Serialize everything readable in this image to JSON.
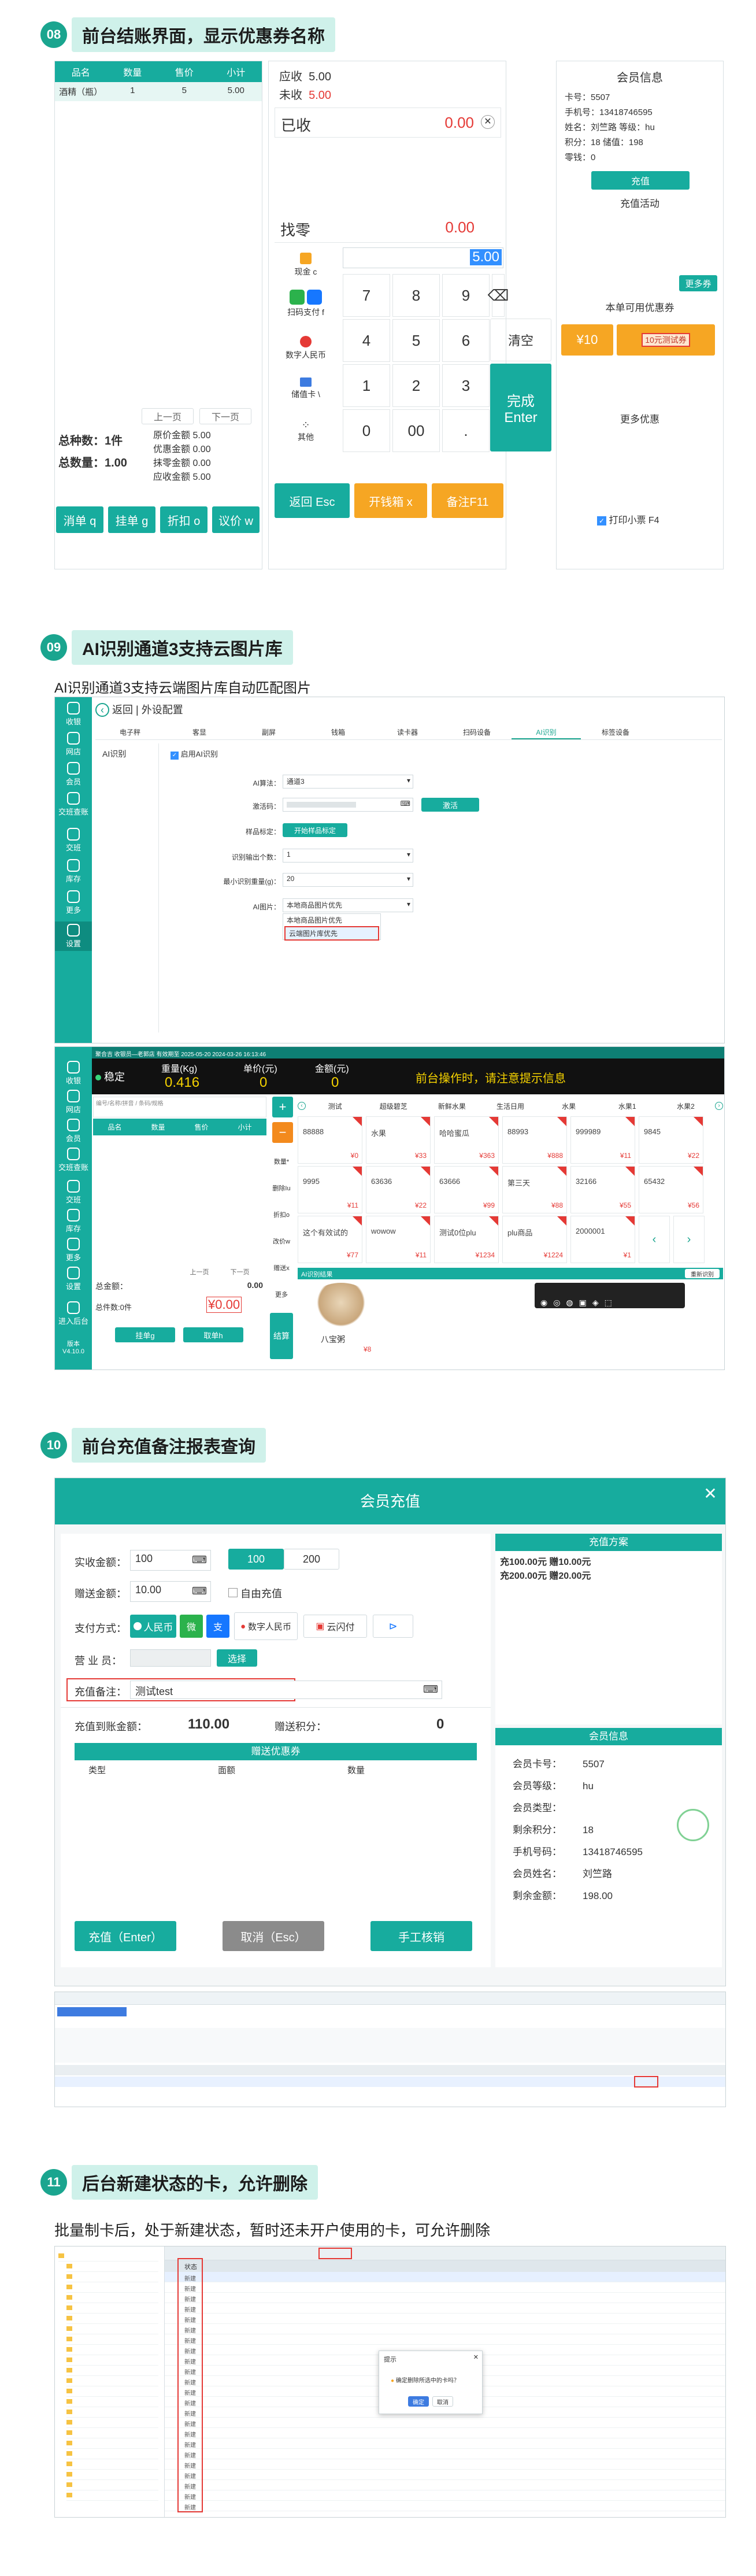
{
  "sec08": {
    "num": "08",
    "title": "前台结账界面，显示优惠券名称",
    "table_headers": [
      "品名",
      "数量",
      "售价",
      "小计"
    ],
    "table_row": [
      "酒精（瓶）",
      "1",
      "5",
      "5.00"
    ],
    "prev": "上一页",
    "next": "下一页",
    "total_kind": "总种数：",
    "total_kind_val": "1件",
    "total_qty": "总数量：",
    "total_qty_val": "1.00",
    "amounts": [
      "原价金额  5.00",
      "优惠金额  0.00",
      "抹零金额  0.00",
      "应收金额  5.00"
    ],
    "bottom_btns": [
      "消单 q",
      "挂单 g",
      "折扣 o",
      "议价 w"
    ],
    "receivable_label": "应收",
    "receivable_val": "5.00",
    "unpaid_label": "未收",
    "unpaid_val": "5.00",
    "paid_label": "已收",
    "paid_val": "0.00",
    "change_label": "找零",
    "change_val": "0.00",
    "amount_input": "5.00",
    "pay_methods": [
      "现金 c",
      "扫码支付 f",
      "数字人民币",
      "储值卡 \\",
      "其他"
    ],
    "keys": [
      "7",
      "8",
      "9",
      "4",
      "5",
      "6",
      "1",
      "2",
      "3",
      "0",
      "00",
      "."
    ],
    "clear": "清空",
    "finish": "完成\nEnter",
    "esc_btn": "返回 Esc",
    "drawer_btn": "开钱箱 x",
    "note_btn": "备注F11",
    "member_title": "会员信息",
    "member_lines": [
      "卡号：5507",
      "手机号：13418746595",
      "姓名：刘竺路  等级：hu",
      "积分：18  储值：198",
      "零钱：0"
    ],
    "recharge": "充值",
    "activity": "充值活动",
    "more": "更多券",
    "usable_coupons": "本单可用优惠券",
    "coupon_val": "¥10",
    "coupon_name": "10元测试券",
    "more_offers": "更多优惠",
    "print_ticket": "打印小票 F4"
  },
  "sec09": {
    "num": "09",
    "title": "AI识别通道3支持云图片库",
    "subtitle": "AI识别通道3支持云端图片库自动匹配图片",
    "side": [
      "收银",
      "网店",
      "会员",
      "交班查账",
      "交班",
      "库存",
      "更多",
      "设置"
    ],
    "back": "返回",
    "page_title": "外设配置",
    "tabs": [
      "电子秤",
      "客显",
      "副屏",
      "钱箱",
      "读卡器",
      "扫码设备",
      "AI识别",
      "标签设备"
    ],
    "left_tab": "AI识别",
    "enable": "启用AI识别",
    "fields": [
      {
        "label": "AI算法：",
        "value": "通道3"
      },
      {
        "label": "激活码：",
        "value": ""
      },
      {
        "label": "样品标定：",
        "value": "开始样品标定"
      },
      {
        "label": "识别输出个数：",
        "value": "1"
      },
      {
        "label": "最小识别重量(g)：",
        "value": "20"
      },
      {
        "label": "AI图片：",
        "value": "本地商品图片优先"
      }
    ],
    "activate": "激活",
    "dropdown_opts": [
      "本地商品图片优先",
      "云端图片库优先"
    ],
    "status_bar": "聚合吉  收银员—老郭店  有效期至 2025-05-20      2024-03-26 16:13:46",
    "stable": "稳定",
    "weight_label": "重量(Kg)",
    "weight_val": "0.416",
    "price_label": "单价(元)",
    "price_val": "0",
    "money_label": "金额(元)",
    "money_val": "0",
    "prompt": "前台操作时，请注意提示信息",
    "side2": [
      "收银",
      "网店",
      "会员",
      "交班查账",
      "交班",
      "库存",
      "更多",
      "设置",
      "进入后台"
    ],
    "version": "版本\nV4.10.0",
    "search_ph": "编号/名称/拼音 / 条码/规格",
    "cart_headers": [
      "品名",
      "数量",
      "售价",
      "小计"
    ],
    "cats": [
      "测试",
      "超级碧芝",
      "新鲜水果",
      "生活日用",
      "水果",
      "水果1",
      "水果2"
    ],
    "mid_btns": [
      "数量*",
      "删除Iu",
      "折扣o",
      "改价w",
      "赠送x",
      "更多"
    ],
    "tiles": [
      {
        "n": "88888",
        "p": "¥0"
      },
      {
        "n": "水果",
        "p": "¥33"
      },
      {
        "n": "哈哈蜜瓜",
        "p": "¥363"
      },
      {
        "n": "88993",
        "p": "¥888"
      },
      {
        "n": "999989",
        "p": "¥11"
      },
      {
        "n": "9845",
        "p": "¥22"
      },
      {
        "n": "9995",
        "p": "¥11"
      },
      {
        "n": "63636",
        "p": "¥22"
      },
      {
        "n": "63666",
        "p": "¥99"
      },
      {
        "n": "第三天",
        "p": "¥88"
      },
      {
        "n": "32166",
        "p": "¥55"
      },
      {
        "n": "65432",
        "p": "¥56"
      },
      {
        "n": "这个有效试的",
        "p": "¥77"
      },
      {
        "n": "wowow",
        "p": "¥11"
      },
      {
        "n": "测试0位plu",
        "p": "¥1234"
      },
      {
        "n": "plu商品",
        "p": "¥1224"
      },
      {
        "n": "2000001",
        "p": "¥1"
      }
    ],
    "ai_bar": "AI识别结果",
    "refresh": "重新识别",
    "food_name": "八宝粥",
    "food_price": "¥8",
    "total_amt": "总金额：",
    "total_amt_val": "0.00",
    "total_qty": "总件数:0件",
    "total_pay": "¥0.00",
    "hang": "挂单g",
    "take": "取单h",
    "checkout": "结算",
    "prev": "上一页",
    "next": "下一页"
  },
  "sec10": {
    "num": "10",
    "title": "前台充值备注报表查询",
    "dlg_title": "会员充值",
    "real_amount": "实收金额：",
    "real_val": "100",
    "opt100": "100",
    "opt200": "200",
    "give_amount": "赠送金额：",
    "give_val": "10.00",
    "free": "自由充值",
    "pay_label": "支付方式：",
    "pays": [
      "人民币",
      "",
      "",
      "数字人民币",
      "云闪付"
    ],
    "clerk": "营 业 员：",
    "select": "选择",
    "remark_label": "充值备注：",
    "remark_val": "测试test",
    "account_label": "充值到账金额：",
    "account_val": "110.00",
    "points_label": "赠送积分：",
    "points_val": "0",
    "coupon_title": "赠送优惠券",
    "coupon_headers": [
      "类型",
      "面额",
      "数量"
    ],
    "plan_title": "充值方案",
    "plans": [
      "充100.00元 赠10.00元",
      "充200.00元 赠20.00元"
    ],
    "member_title": "会员信息",
    "member": [
      [
        "会员卡号：",
        "5507"
      ],
      [
        "会员等级：",
        "hu"
      ],
      [
        "会员类型：",
        ""
      ],
      [
        "剩余积分：",
        "18"
      ],
      [
        "手机号码：",
        "13418746595"
      ],
      [
        "会员姓名：",
        "刘竺路"
      ],
      [
        "剩余金额：",
        "198.00"
      ]
    ],
    "btn_recharge": "充值（Enter）",
    "btn_cancel": "取消（Esc）",
    "btn_manual": "手工核销"
  },
  "sec11": {
    "num": "11",
    "title": "后台新建状态的卡，允许删除",
    "subtitle": "批量制卡后，处于新建状态，暂时还未开户使用的卡，可允许删除",
    "status_col": "状态",
    "status_val": "新建",
    "dialog_title": "提示",
    "dialog_text": "确定删除所选中的卡吗？",
    "dialog_ok": "确定",
    "dialog_cancel": "取消"
  }
}
